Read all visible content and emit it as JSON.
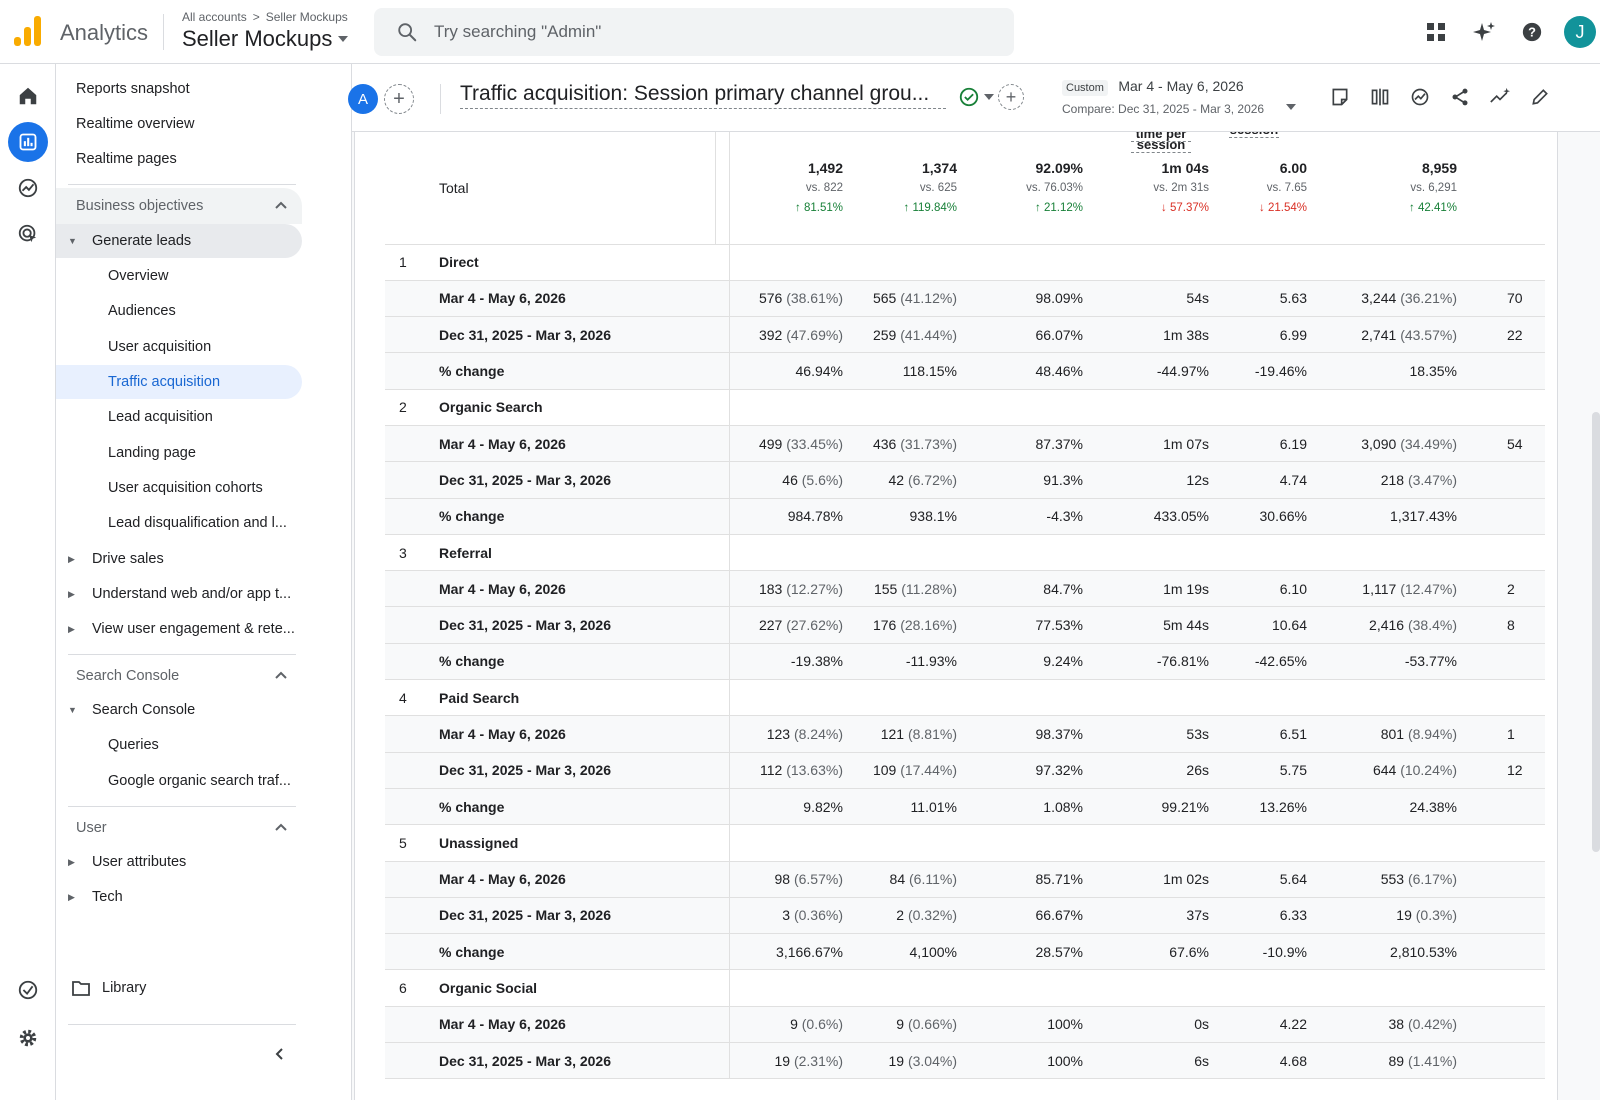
{
  "app": {
    "brand": "Analytics",
    "breadcrumb_root": "All accounts",
    "breadcrumb_sep": ">",
    "breadcrumb_leaf": "Seller Mockups",
    "property": "Seller Mockups",
    "search_placeholder": "Try searching \"Admin\"",
    "avatar_letter": "J",
    "accent": "#1a73e8",
    "logo_color": "#f9ab00"
  },
  "nav": {
    "top_items": [
      "Reports snapshot",
      "Realtime overview",
      "Realtime pages"
    ],
    "section_business": "Business objectives",
    "generate_leads": "Generate leads",
    "generate_leads_children": [
      "Overview",
      "Audiences",
      "User acquisition",
      "Traffic acquisition",
      "Lead acquisition",
      "Landing page",
      "User acquisition cohorts",
      "Lead disqualification and l..."
    ],
    "selected": "Traffic acquisition",
    "collapsed_items": [
      "Drive sales",
      "Understand web and/or app t...",
      "View user engagement & rete..."
    ],
    "section_search_console": "Search Console",
    "search_console": "Search Console",
    "search_console_children": [
      "Queries",
      "Google organic search traf..."
    ],
    "section_user": "User",
    "user_items": [
      "User attributes",
      "Tech"
    ],
    "library": "Library"
  },
  "report": {
    "comparison_badge": "A",
    "title": "Traffic acquisition: Session primary channel grou...",
    "date_custom": "Custom",
    "date_range": "Mar 4 - May 6, 2026",
    "date_compare": "Compare: Dec 31, 2025 - Mar 3, 2026"
  },
  "table": {
    "partial_headers": [
      "time per",
      "session",
      "session"
    ],
    "total_label": "Total",
    "totals": [
      {
        "value": "1,492",
        "vs": "vs. 822",
        "change": "81.51%",
        "dir": "up"
      },
      {
        "value": "1,374",
        "vs": "vs. 625",
        "change": "119.84%",
        "dir": "up"
      },
      {
        "value": "92.09%",
        "vs": "vs. 76.03%",
        "change": "21.12%",
        "dir": "up"
      },
      {
        "value": "1m 04s",
        "vs": "vs. 2m 31s",
        "change": "57.37%",
        "dir": "down"
      },
      {
        "value": "6.00",
        "vs": "vs. 7.65",
        "change": "21.54%",
        "dir": "down"
      },
      {
        "value": "8,959",
        "vs": "vs. 6,291",
        "change": "42.41%",
        "dir": "up"
      }
    ],
    "groups": [
      {
        "idx": "1",
        "name": "Direct",
        "rows": [
          {
            "label": "Mar 4 - May 6, 2026",
            "c": [
              "576",
              "(38.61%)",
              "565",
              "(41.12%)",
              "98.09%",
              "54s",
              "5.63",
              "3,244",
              "(36.21%)",
              "70"
            ]
          },
          {
            "label": "Dec 31, 2025 - Mar 3, 2026",
            "c": [
              "392",
              "(47.69%)",
              "259",
              "(41.44%)",
              "66.07%",
              "1m 38s",
              "6.99",
              "2,741",
              "(43.57%)",
              "22"
            ]
          },
          {
            "label": "% change",
            "c": [
              "46.94%",
              "",
              "118.15%",
              "",
              "48.46%",
              "-44.97%",
              "-19.46%",
              "18.35%",
              "",
              ""
            ]
          }
        ]
      },
      {
        "idx": "2",
        "name": "Organic Search",
        "rows": [
          {
            "label": "Mar 4 - May 6, 2026",
            "c": [
              "499",
              "(33.45%)",
              "436",
              "(31.73%)",
              "87.37%",
              "1m 07s",
              "6.19",
              "3,090",
              "(34.49%)",
              "54"
            ]
          },
          {
            "label": "Dec 31, 2025 - Mar 3, 2026",
            "c": [
              "46",
              "(5.6%)",
              "42",
              "(6.72%)",
              "91.3%",
              "12s",
              "4.74",
              "218",
              "(3.47%)",
              ""
            ]
          },
          {
            "label": "% change",
            "c": [
              "984.78%",
              "",
              "938.1%",
              "",
              "-4.3%",
              "433.05%",
              "30.66%",
              "1,317.43%",
              "",
              ""
            ]
          }
        ]
      },
      {
        "idx": "3",
        "name": "Referral",
        "rows": [
          {
            "label": "Mar 4 - May 6, 2026",
            "c": [
              "183",
              "(12.27%)",
              "155",
              "(11.28%)",
              "84.7%",
              "1m 19s",
              "6.10",
              "1,117",
              "(12.47%)",
              "2"
            ]
          },
          {
            "label": "Dec 31, 2025 - Mar 3, 2026",
            "c": [
              "227",
              "(27.62%)",
              "176",
              "(28.16%)",
              "77.53%",
              "5m 44s",
              "10.64",
              "2,416",
              "(38.4%)",
              "8"
            ]
          },
          {
            "label": "% change",
            "c": [
              "-19.38%",
              "",
              "-11.93%",
              "",
              "9.24%",
              "-76.81%",
              "-42.65%",
              "-53.77%",
              "",
              ""
            ]
          }
        ]
      },
      {
        "idx": "4",
        "name": "Paid Search",
        "rows": [
          {
            "label": "Mar 4 - May 6, 2026",
            "c": [
              "123",
              "(8.24%)",
              "121",
              "(8.81%)",
              "98.37%",
              "53s",
              "6.51",
              "801",
              "(8.94%)",
              "1"
            ]
          },
          {
            "label": "Dec 31, 2025 - Mar 3, 2026",
            "c": [
              "112",
              "(13.63%)",
              "109",
              "(17.44%)",
              "97.32%",
              "26s",
              "5.75",
              "644",
              "(10.24%)",
              "12"
            ]
          },
          {
            "label": "% change",
            "c": [
              "9.82%",
              "",
              "11.01%",
              "",
              "1.08%",
              "99.21%",
              "13.26%",
              "24.38%",
              "",
              ""
            ]
          }
        ]
      },
      {
        "idx": "5",
        "name": "Unassigned",
        "rows": [
          {
            "label": "Mar 4 - May 6, 2026",
            "c": [
              "98",
              "(6.57%)",
              "84",
              "(6.11%)",
              "85.71%",
              "1m 02s",
              "5.64",
              "553",
              "(6.17%)",
              ""
            ]
          },
          {
            "label": "Dec 31, 2025 - Mar 3, 2026",
            "c": [
              "3",
              "(0.36%)",
              "2",
              "(0.32%)",
              "66.67%",
              "37s",
              "6.33",
              "19",
              "(0.3%)",
              ""
            ]
          },
          {
            "label": "% change",
            "c": [
              "3,166.67%",
              "",
              "4,100%",
              "",
              "28.57%",
              "67.6%",
              "-10.9%",
              "2,810.53%",
              "",
              ""
            ]
          }
        ]
      },
      {
        "idx": "6",
        "name": "Organic Social",
        "rows": [
          {
            "label": "Mar 4 - May 6, 2026",
            "c": [
              "9",
              "(0.6%)",
              "9",
              "(0.66%)",
              "100%",
              "0s",
              "4.22",
              "38",
              "(0.42%)",
              ""
            ]
          },
          {
            "label": "Dec 31, 2025 - Mar 3, 2026",
            "c": [
              "19",
              "(2.31%)",
              "19",
              "(3.04%)",
              "100%",
              "6s",
              "4.68",
              "89",
              "(1.41%)",
              ""
            ]
          }
        ]
      }
    ]
  }
}
